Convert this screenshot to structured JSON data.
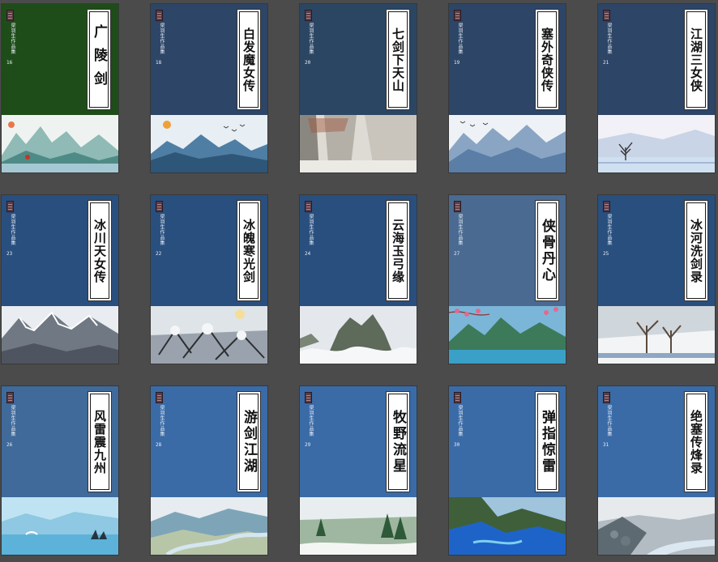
{
  "series_label": "梁羽生作品集",
  "books": [
    {
      "title": "广陵剑",
      "volume": "16",
      "cover_color": "#1f4d1a",
      "scene": "misty-lake"
    },
    {
      "title": "白发魔女传",
      "volume": "18",
      "cover_color": "#2d4566",
      "scene": "blue-mountains"
    },
    {
      "title": "七剑下天山",
      "volume": "20",
      "cover_color": "#2b4663",
      "scene": "grey-cliffs"
    },
    {
      "title": "塞外奇侠传",
      "volume": "19",
      "cover_color": "#2d4566",
      "scene": "ink-peaks"
    },
    {
      "title": "江湖三女侠",
      "volume": "21",
      "cover_color": "#2d4566",
      "scene": "lone-tree"
    },
    {
      "title": "冰川天女传",
      "volume": "23",
      "cover_color": "#294f7e",
      "scene": "snow-ridge"
    },
    {
      "title": "冰魄寒光剑",
      "volume": "22",
      "cover_color": "#294f7e",
      "scene": "snow-branches"
    },
    {
      "title": "云海玉弓缘",
      "volume": "24",
      "cover_color": "#294f7e",
      "scene": "cloud-sea"
    },
    {
      "title": "侠骨丹心",
      "volume": "27",
      "cover_color": "#4a6a91",
      "scene": "blossom-lake"
    },
    {
      "title": "冰河洗剑录",
      "volume": "25",
      "cover_color": "#294f7e",
      "scene": "winter-trees"
    },
    {
      "title": "风雷震九州",
      "volume": "26",
      "cover_color": "#3f6a9a",
      "scene": "crane-lake"
    },
    {
      "title": "游剑江湖",
      "volume": "28",
      "cover_color": "#3a6ba7",
      "scene": "river-valley"
    },
    {
      "title": "牧野流星",
      "volume": "29",
      "cover_color": "#3a6ba7",
      "scene": "pine-meadow"
    },
    {
      "title": "弹指惊雷",
      "volume": "30",
      "cover_color": "#3a6ba7",
      "scene": "blue-cliffs"
    },
    {
      "title": "绝塞传烽录",
      "volume": "31",
      "cover_color": "#3a6ba7",
      "scene": "stone-river"
    }
  ]
}
